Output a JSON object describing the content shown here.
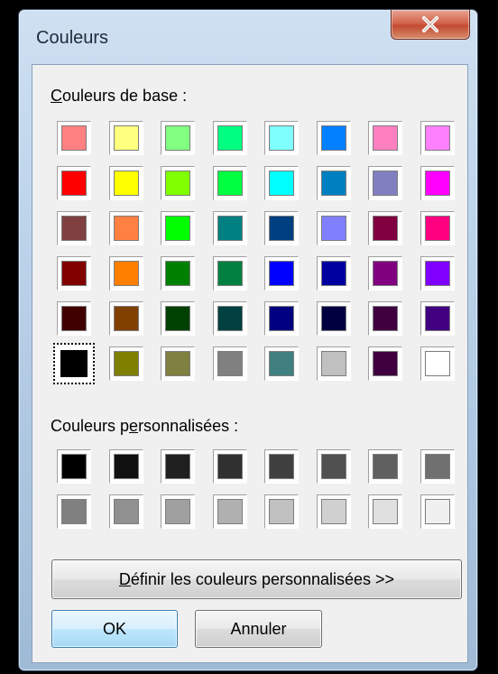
{
  "window": {
    "title": "Couleurs"
  },
  "labels": {
    "base_colors_pre": "",
    "base_colors_key": "C",
    "base_colors_post": "ouleurs de base :",
    "custom_colors_pre": "Couleurs p",
    "custom_colors_key": "e",
    "custom_colors_post": "rsonnalisées :"
  },
  "buttons": {
    "define_key": "D",
    "define_rest": "éfinir les couleurs personnalisées >>",
    "ok": "OK",
    "cancel": "Annuler"
  },
  "icons": {
    "close": "close-x-icon"
  },
  "base_colors": [
    [
      "#ff8080",
      "#ffff80",
      "#80ff80",
      "#00ff80",
      "#80ffff",
      "#0080ff",
      "#ff80c0",
      "#ff80ff"
    ],
    [
      "#ff0000",
      "#ffff00",
      "#80ff00",
      "#00ff40",
      "#00ffff",
      "#0080c0",
      "#8080c0",
      "#ff00ff"
    ],
    [
      "#804040",
      "#ff8040",
      "#00ff00",
      "#008080",
      "#004080",
      "#8080ff",
      "#800040",
      "#ff0080"
    ],
    [
      "#800000",
      "#ff8000",
      "#008000",
      "#008040",
      "#0000ff",
      "#0000a0",
      "#800080",
      "#8000ff"
    ],
    [
      "#400000",
      "#804000",
      "#004000",
      "#004040",
      "#000080",
      "#000040",
      "#400040",
      "#400080"
    ],
    [
      "#000000",
      "#808000",
      "#808040",
      "#808080",
      "#408080",
      "#c0c0c0",
      "#400040",
      "#ffffff"
    ]
  ],
  "selected_base_color": "#000000",
  "custom_colors": [
    [
      "#000000",
      "#101010",
      "#202020",
      "#303030",
      "#404040",
      "#505050",
      "#606060",
      "#707070"
    ],
    [
      "#808080",
      "#909090",
      "#a0a0a0",
      "#b0b0b0",
      "#c0c0c0",
      "#d0d0d0",
      "#e0e0e0",
      "#f0f0f0"
    ]
  ]
}
